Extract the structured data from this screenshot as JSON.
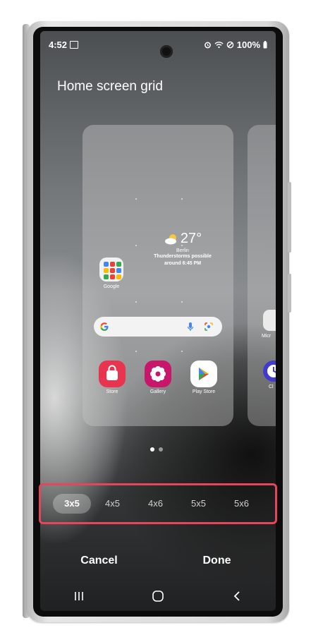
{
  "status_bar": {
    "time": "4:52",
    "battery": "100%",
    "icons": [
      "image-icon",
      "alarm-icon",
      "wifi-icon",
      "do-not-disturb-icon",
      "battery-icon"
    ]
  },
  "page": {
    "title": "Home screen grid"
  },
  "preview": {
    "weather": {
      "temperature": "27°",
      "city": "Berlin",
      "description_line1": "Thunderstorms possible",
      "description_line2": "around 6:45 PM"
    },
    "folder_label": "Google",
    "apps": [
      {
        "label": "Store",
        "icon": "store-icon",
        "color": "#e8344e"
      },
      {
        "label": "Gallery",
        "icon": "gallery-icon",
        "color": "#c8176a"
      },
      {
        "label": "Play Store",
        "icon": "play-store-icon",
        "color": "#ffffff"
      }
    ],
    "next_page_labels": [
      "Micr",
      "Cl"
    ]
  },
  "page_indicator": {
    "count": 2,
    "active": 1
  },
  "grid_options": [
    "3x5",
    "4x5",
    "4x6",
    "5x5",
    "5x6"
  ],
  "selected_grid": "3x5",
  "actions": {
    "cancel": "Cancel",
    "done": "Done"
  },
  "navigation": {
    "icons": [
      "recents-icon",
      "home-icon",
      "back-icon"
    ]
  },
  "colors": {
    "highlight": "#e6455c"
  }
}
